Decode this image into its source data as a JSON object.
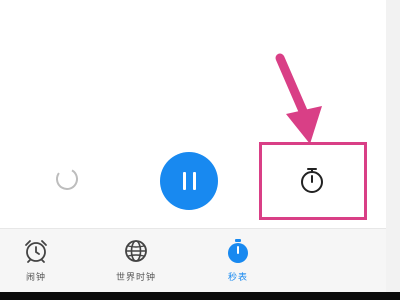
{
  "controls": {
    "reset_icon": "reset-circle-icon",
    "pause_icon": "pause-icon",
    "lap_icon": "stopwatch-icon",
    "pause_color": "#1889f0"
  },
  "annotation": {
    "arrow_color": "#d93f86",
    "box_color": "#d93f86"
  },
  "tabbar": {
    "tabs": [
      {
        "label": "闹钟",
        "icon": "alarm-clock-icon",
        "active": false
      },
      {
        "label": "世界时钟",
        "icon": "globe-icon",
        "active": false
      },
      {
        "label": "秒表",
        "icon": "stopwatch-icon",
        "active": true
      }
    ],
    "active_color": "#1889f0"
  }
}
